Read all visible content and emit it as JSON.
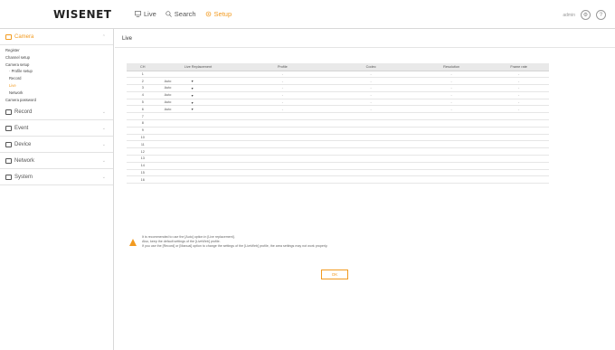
{
  "brand": {
    "logo": "WISENET",
    "accent": "#f29a1f"
  },
  "topnav": {
    "live": "Live",
    "search": "Search",
    "setup": "Setup"
  },
  "header_right": {
    "user": "admin",
    "icon1": "settings-icon",
    "icon2": "help-icon"
  },
  "sidebar": {
    "camera": {
      "label": "Camera",
      "items": [
        "Register",
        "Channel setup",
        "Camera setup",
        "Profile setup",
        "Record",
        "Live",
        "Network",
        "Camera password"
      ]
    },
    "record": "Record",
    "event": "Event",
    "device": "Device",
    "network": "Network",
    "system": "System"
  },
  "page": {
    "title": "Live"
  },
  "table": {
    "headers": [
      "CH",
      "Live Replacement",
      "Profile",
      "Codec",
      "Resolution",
      "Frame rate"
    ],
    "rows": [
      {
        "ch": "1",
        "replace": "",
        "profile": "-",
        "codec": "-",
        "res": "-",
        "fps": "-"
      },
      {
        "ch": "2",
        "replace": "Auto",
        "profile": "-",
        "codec": "-",
        "res": "-",
        "fps": "-"
      },
      {
        "ch": "3",
        "replace": "Auto",
        "profile": "-",
        "codec": "-",
        "res": "-",
        "fps": "-"
      },
      {
        "ch": "4",
        "replace": "Auto",
        "profile": "-",
        "codec": "-",
        "res": "-",
        "fps": "-"
      },
      {
        "ch": "5",
        "replace": "Auto",
        "profile": "-",
        "codec": "-",
        "res": "-",
        "fps": "-"
      },
      {
        "ch": "6",
        "replace": "Auto",
        "profile": "-",
        "codec": "-",
        "res": "-",
        "fps": "-"
      },
      {
        "ch": "7",
        "replace": "",
        "profile": "",
        "codec": "",
        "res": "",
        "fps": ""
      },
      {
        "ch": "8",
        "replace": "",
        "profile": "",
        "codec": "",
        "res": "",
        "fps": ""
      },
      {
        "ch": "9",
        "replace": "",
        "profile": "",
        "codec": "",
        "res": "",
        "fps": ""
      },
      {
        "ch": "10",
        "replace": "",
        "profile": "",
        "codec": "",
        "res": "",
        "fps": ""
      },
      {
        "ch": "11",
        "replace": "",
        "profile": "",
        "codec": "",
        "res": "",
        "fps": ""
      },
      {
        "ch": "12",
        "replace": "",
        "profile": "",
        "codec": "",
        "res": "",
        "fps": ""
      },
      {
        "ch": "13",
        "replace": "",
        "profile": "",
        "codec": "",
        "res": "",
        "fps": ""
      },
      {
        "ch": "14",
        "replace": "",
        "profile": "",
        "codec": "",
        "res": "",
        "fps": ""
      },
      {
        "ch": "15",
        "replace": "",
        "profile": "",
        "codec": "",
        "res": "",
        "fps": ""
      },
      {
        "ch": "16",
        "replace": "",
        "profile": "",
        "codec": "",
        "res": "",
        "fps": ""
      }
    ]
  },
  "notice": {
    "line1": "It is recommended to use the [Auto] option in [Live replacement].",
    "line2": "Also, keep the default settings of the [LiveWeb] profile.",
    "line3": "If you use the [Record] or [Manual] option to change the settings of the [LiveWeb] profile, the area settings may not work properly."
  },
  "ok_button": "OK"
}
